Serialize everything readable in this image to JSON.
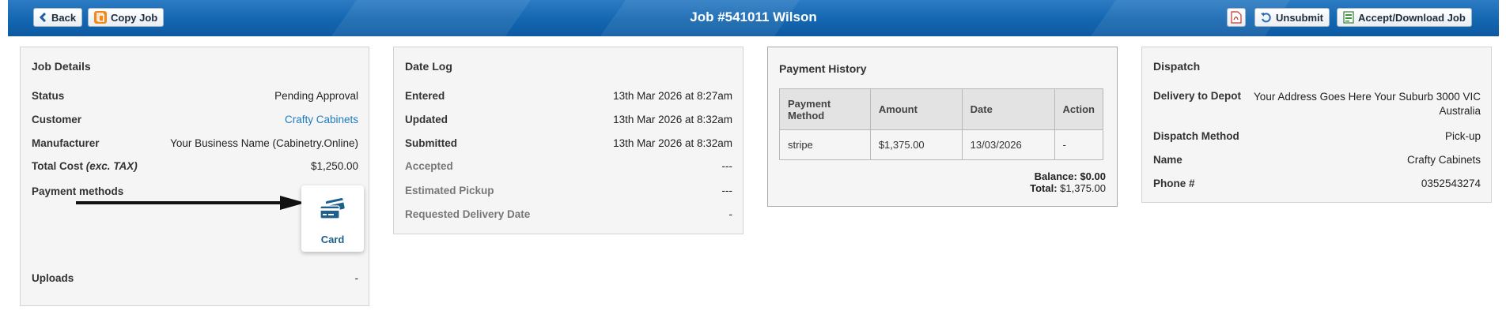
{
  "header": {
    "title": "Job #541011 Wilson",
    "back_label": "Back",
    "copy_label": "Copy Job",
    "unsubmit_label": "Unsubmit",
    "accept_label": "Accept/Download Job",
    "bar_color": "#1466b0"
  },
  "job_details": {
    "title": "Job Details",
    "rows": [
      {
        "label": "Status",
        "value": "Pending Approval"
      },
      {
        "label": "Customer",
        "value": "Crafty Cabinets"
      },
      {
        "label": "Manufacturer",
        "value": "Your Business Name (Cabinetry.Online)"
      },
      {
        "label": "Total Cost",
        "label_em": "(exc. TAX)",
        "value": "$1,250.00"
      }
    ],
    "payment_methods_label": "Payment methods",
    "card_label": "Card",
    "uploads_label": "Uploads",
    "uploads_value": "-"
  },
  "date_log": {
    "title": "Date Log",
    "rows": [
      {
        "label": "Entered",
        "value": "13th Mar 2026 at 8:27am"
      },
      {
        "label": "Updated",
        "value": "13th Mar 2026 at 8:32am"
      },
      {
        "label": "Submitted",
        "value": "13th Mar 2026 at 8:32am"
      },
      {
        "label": "Accepted",
        "value": "---"
      },
      {
        "label": "Estimated Pickup",
        "value": "---"
      },
      {
        "label": "Requested Delivery Date",
        "value": "-"
      }
    ]
  },
  "payment_history": {
    "title": "Payment History",
    "columns": [
      "Payment Method",
      "Amount",
      "Date",
      "Action"
    ],
    "rows": [
      [
        "stripe",
        "$1,375.00",
        "13/03/2026",
        "-"
      ]
    ],
    "balance_label": "Balance:",
    "balance_value": "$0.00",
    "total_label": "Total:",
    "total_value": "$1,375.00"
  },
  "dispatch": {
    "title": "Dispatch",
    "delivery_label": "Delivery to Depot",
    "delivery_line1": "Your Address Goes Here Your Suburb 3000 VIC",
    "delivery_line2": "Australia",
    "rows": [
      {
        "label": "Dispatch Method",
        "value": "Pick-up"
      },
      {
        "label": "Name",
        "value": "Crafty Cabinets"
      },
      {
        "label": "Phone #",
        "value": "0352543274"
      }
    ]
  }
}
